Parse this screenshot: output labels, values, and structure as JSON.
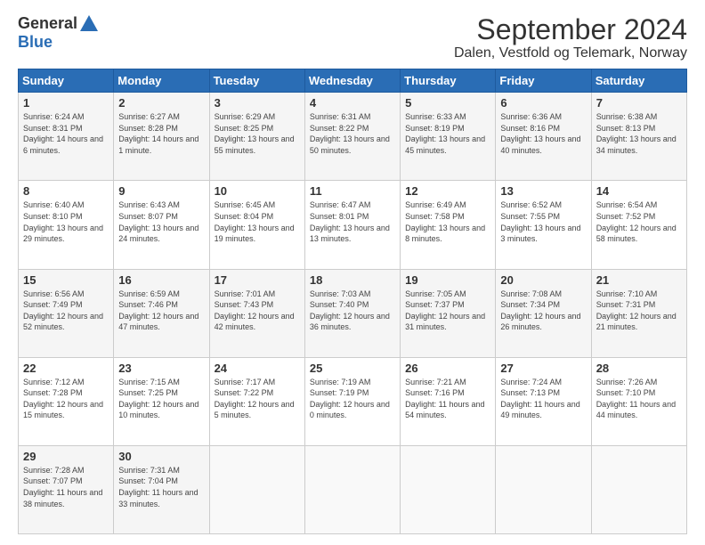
{
  "logo": {
    "general": "General",
    "blue": "Blue"
  },
  "header": {
    "title": "September 2024",
    "subtitle": "Dalen, Vestfold og Telemark, Norway"
  },
  "days": [
    "Sunday",
    "Monday",
    "Tuesday",
    "Wednesday",
    "Thursday",
    "Friday",
    "Saturday"
  ],
  "weeks": [
    [
      {
        "num": "1",
        "sunrise": "6:24 AM",
        "sunset": "8:31 PM",
        "daylight": "14 hours and 6 minutes."
      },
      {
        "num": "2",
        "sunrise": "6:27 AM",
        "sunset": "8:28 PM",
        "daylight": "14 hours and 1 minute."
      },
      {
        "num": "3",
        "sunrise": "6:29 AM",
        "sunset": "8:25 PM",
        "daylight": "13 hours and 55 minutes."
      },
      {
        "num": "4",
        "sunrise": "6:31 AM",
        "sunset": "8:22 PM",
        "daylight": "13 hours and 50 minutes."
      },
      {
        "num": "5",
        "sunrise": "6:33 AM",
        "sunset": "8:19 PM",
        "daylight": "13 hours and 45 minutes."
      },
      {
        "num": "6",
        "sunrise": "6:36 AM",
        "sunset": "8:16 PM",
        "daylight": "13 hours and 40 minutes."
      },
      {
        "num": "7",
        "sunrise": "6:38 AM",
        "sunset": "8:13 PM",
        "daylight": "13 hours and 34 minutes."
      }
    ],
    [
      {
        "num": "8",
        "sunrise": "6:40 AM",
        "sunset": "8:10 PM",
        "daylight": "13 hours and 29 minutes."
      },
      {
        "num": "9",
        "sunrise": "6:43 AM",
        "sunset": "8:07 PM",
        "daylight": "13 hours and 24 minutes."
      },
      {
        "num": "10",
        "sunrise": "6:45 AM",
        "sunset": "8:04 PM",
        "daylight": "13 hours and 19 minutes."
      },
      {
        "num": "11",
        "sunrise": "6:47 AM",
        "sunset": "8:01 PM",
        "daylight": "13 hours and 13 minutes."
      },
      {
        "num": "12",
        "sunrise": "6:49 AM",
        "sunset": "7:58 PM",
        "daylight": "13 hours and 8 minutes."
      },
      {
        "num": "13",
        "sunrise": "6:52 AM",
        "sunset": "7:55 PM",
        "daylight": "13 hours and 3 minutes."
      },
      {
        "num": "14",
        "sunrise": "6:54 AM",
        "sunset": "7:52 PM",
        "daylight": "12 hours and 58 minutes."
      }
    ],
    [
      {
        "num": "15",
        "sunrise": "6:56 AM",
        "sunset": "7:49 PM",
        "daylight": "12 hours and 52 minutes."
      },
      {
        "num": "16",
        "sunrise": "6:59 AM",
        "sunset": "7:46 PM",
        "daylight": "12 hours and 47 minutes."
      },
      {
        "num": "17",
        "sunrise": "7:01 AM",
        "sunset": "7:43 PM",
        "daylight": "12 hours and 42 minutes."
      },
      {
        "num": "18",
        "sunrise": "7:03 AM",
        "sunset": "7:40 PM",
        "daylight": "12 hours and 36 minutes."
      },
      {
        "num": "19",
        "sunrise": "7:05 AM",
        "sunset": "7:37 PM",
        "daylight": "12 hours and 31 minutes."
      },
      {
        "num": "20",
        "sunrise": "7:08 AM",
        "sunset": "7:34 PM",
        "daylight": "12 hours and 26 minutes."
      },
      {
        "num": "21",
        "sunrise": "7:10 AM",
        "sunset": "7:31 PM",
        "daylight": "12 hours and 21 minutes."
      }
    ],
    [
      {
        "num": "22",
        "sunrise": "7:12 AM",
        "sunset": "7:28 PM",
        "daylight": "12 hours and 15 minutes."
      },
      {
        "num": "23",
        "sunrise": "7:15 AM",
        "sunset": "7:25 PM",
        "daylight": "12 hours and 10 minutes."
      },
      {
        "num": "24",
        "sunrise": "7:17 AM",
        "sunset": "7:22 PM",
        "daylight": "12 hours and 5 minutes."
      },
      {
        "num": "25",
        "sunrise": "7:19 AM",
        "sunset": "7:19 PM",
        "daylight": "12 hours and 0 minutes."
      },
      {
        "num": "26",
        "sunrise": "7:21 AM",
        "sunset": "7:16 PM",
        "daylight": "11 hours and 54 minutes."
      },
      {
        "num": "27",
        "sunrise": "7:24 AM",
        "sunset": "7:13 PM",
        "daylight": "11 hours and 49 minutes."
      },
      {
        "num": "28",
        "sunrise": "7:26 AM",
        "sunset": "7:10 PM",
        "daylight": "11 hours and 44 minutes."
      }
    ],
    [
      {
        "num": "29",
        "sunrise": "7:28 AM",
        "sunset": "7:07 PM",
        "daylight": "11 hours and 38 minutes."
      },
      {
        "num": "30",
        "sunrise": "7:31 AM",
        "sunset": "7:04 PM",
        "daylight": "11 hours and 33 minutes."
      },
      null,
      null,
      null,
      null,
      null
    ]
  ],
  "labels": {
    "sunrise": "Sunrise:",
    "sunset": "Sunset:",
    "daylight": "Daylight:"
  }
}
